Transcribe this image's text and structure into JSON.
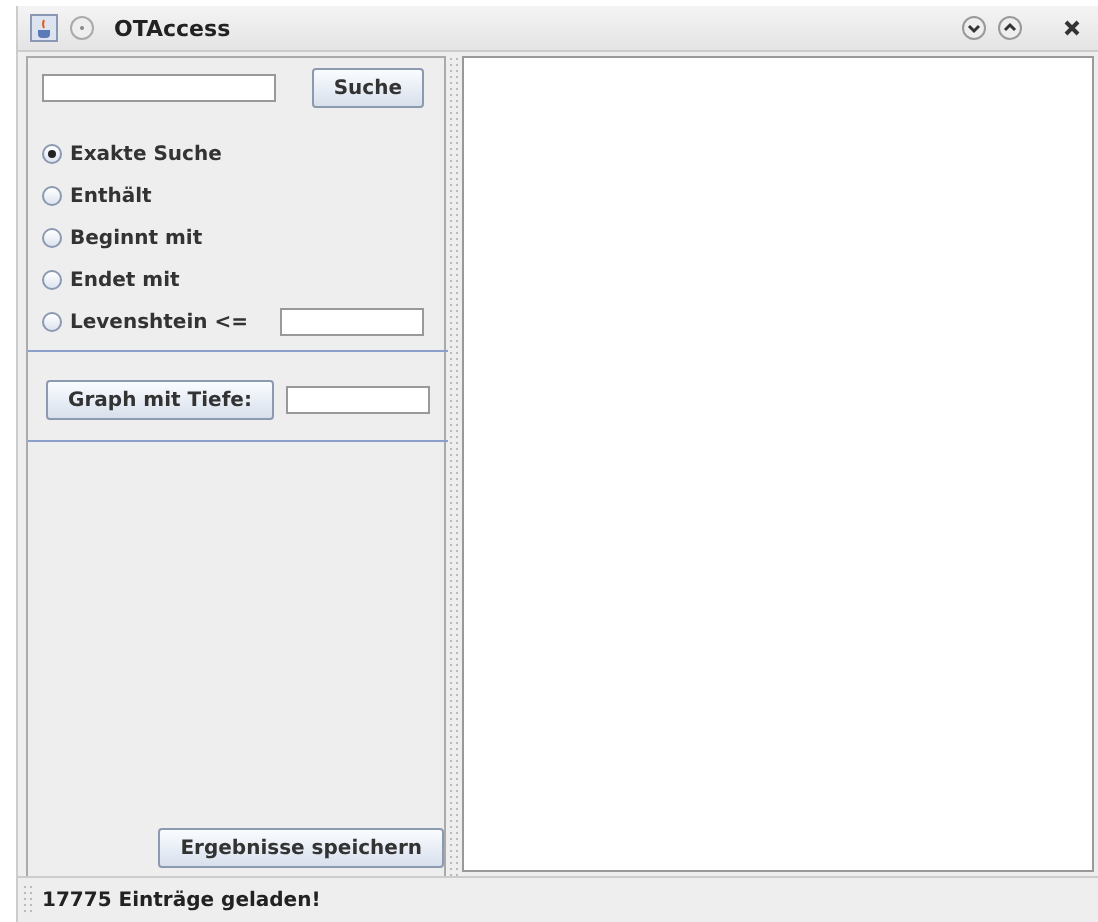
{
  "window": {
    "title": "OTAccess"
  },
  "search": {
    "button": "Suche"
  },
  "options": [
    {
      "label": "Exakte Suche",
      "selected": true,
      "kind": "plain"
    },
    {
      "label": "Enthält",
      "selected": false,
      "kind": "plain"
    },
    {
      "label": "Beginnt mit",
      "selected": false,
      "kind": "plain"
    },
    {
      "label": "Endet mit",
      "selected": false,
      "kind": "plain"
    },
    {
      "label": "Levenshtein <=",
      "selected": false,
      "kind": "field"
    }
  ],
  "graph": {
    "button": "Graph mit Tiefe:"
  },
  "save_button": "Ergebnisse speichern",
  "status_bar": "17775 Einträge geladen!"
}
